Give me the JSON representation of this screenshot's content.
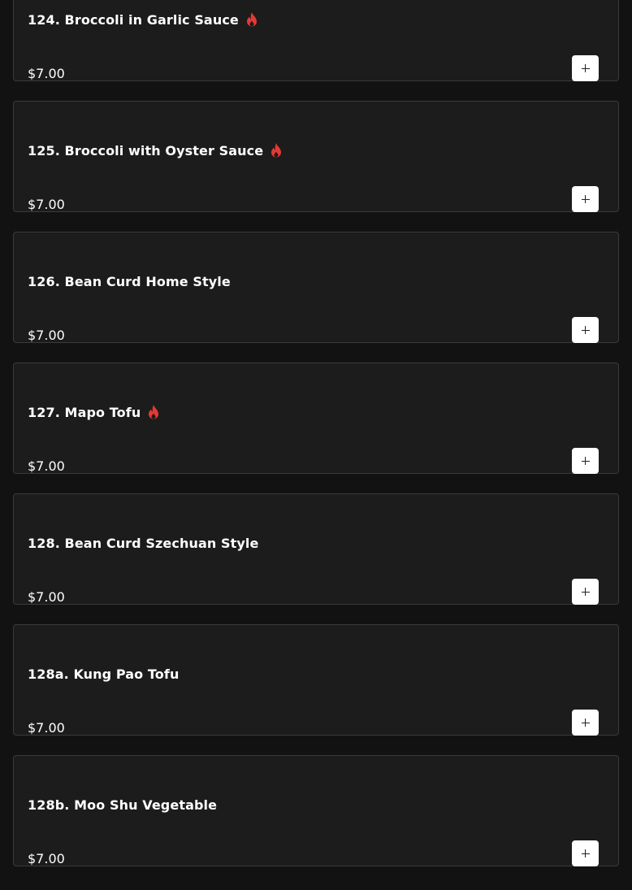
{
  "colors": {
    "background": "#121212",
    "card_background": "#1c1c1c",
    "card_border": "#3a3a3a",
    "spicy_icon": "#e53935",
    "add_button": "#ffffff"
  },
  "icons": {
    "spicy": "flame-icon",
    "add": "plus-icon"
  },
  "menu_items": [
    {
      "name": "124. Broccoli in Garlic Sauce",
      "price": "$7.00",
      "spicy": true
    },
    {
      "name": "125. Broccoli with Oyster Sauce",
      "price": "$7.00",
      "spicy": true
    },
    {
      "name": "126. Bean Curd Home Style",
      "price": "$7.00",
      "spicy": false
    },
    {
      "name": "127. Mapo Tofu",
      "price": "$7.00",
      "spicy": true
    },
    {
      "name": "128. Bean Curd Szechuan Style",
      "price": "$7.00",
      "spicy": false
    },
    {
      "name": "128a. Kung Pao Tofu",
      "price": "$7.00",
      "spicy": false
    },
    {
      "name": "128b. Moo Shu Vegetable",
      "price": "$7.00",
      "spicy": false
    }
  ]
}
